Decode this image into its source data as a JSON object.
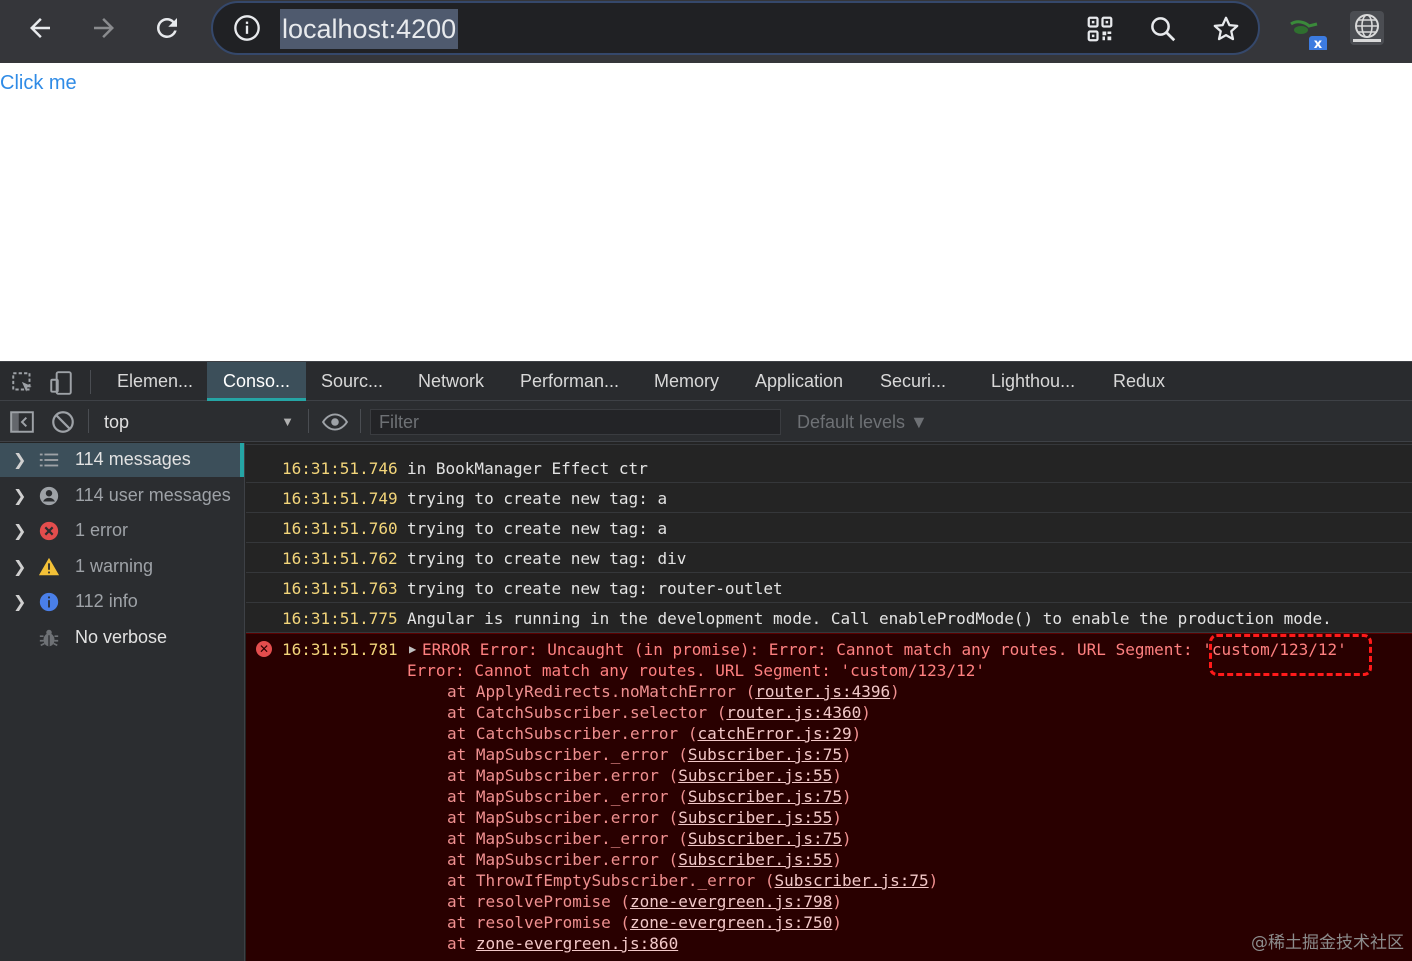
{
  "browser": {
    "url": "localhost:4200",
    "ext_badge": "x"
  },
  "page": {
    "link_text": "Click me"
  },
  "devtools": {
    "tabs": [
      {
        "label": "Elemen..."
      },
      {
        "label": "Conso..."
      },
      {
        "label": "Sourc..."
      },
      {
        "label": "Network"
      },
      {
        "label": "Performan..."
      },
      {
        "label": "Memory"
      },
      {
        "label": "Application"
      },
      {
        "label": "Securi..."
      },
      {
        "label": "Lighthou..."
      },
      {
        "label": "Redux"
      }
    ],
    "context": "top",
    "filter_placeholder": "Filter",
    "levels": "Default levels ▼",
    "sidebar": [
      {
        "label": "114 messages"
      },
      {
        "label": "114 user messages"
      },
      {
        "label": "1 error"
      },
      {
        "label": "1 warning"
      },
      {
        "label": "112 info"
      },
      {
        "label": "No verbose"
      }
    ],
    "logs": [
      {
        "time": "16:31:51.746",
        "text": "in BookManager Effect ctr"
      },
      {
        "time": "16:31:51.749",
        "text": "trying to create new tag: a"
      },
      {
        "time": "16:31:51.760",
        "text": "trying to create new tag: a"
      },
      {
        "time": "16:31:51.762",
        "text": "trying to create new tag: div"
      },
      {
        "time": "16:31:51.763",
        "text": "trying to create new tag: router-outlet"
      },
      {
        "time": "16:31:51.775",
        "text": "Angular is running in the development mode. Call enableProdMode() to enable the production mode."
      }
    ],
    "error": {
      "time": "16:31:51.781",
      "headline": "ERROR Error: Uncaught (in promise): Error: Cannot match any routes. URL Segment: ",
      "segment": "'custom/123/12'",
      "line2": "Error: Cannot match any routes. URL Segment: 'custom/123/12'",
      "stack": [
        {
          "fn": "at ApplyRedirects.noMatchError (",
          "src": "router.js:4396",
          "end": ")"
        },
        {
          "fn": "at CatchSubscriber.selector (",
          "src": "router.js:4360",
          "end": ")"
        },
        {
          "fn": "at CatchSubscriber.error (",
          "src": "catchError.js:29",
          "end": ")"
        },
        {
          "fn": "at MapSubscriber._error (",
          "src": "Subscriber.js:75",
          "end": ")"
        },
        {
          "fn": "at MapSubscriber.error (",
          "src": "Subscriber.js:55",
          "end": ")"
        },
        {
          "fn": "at MapSubscriber._error (",
          "src": "Subscriber.js:75",
          "end": ")"
        },
        {
          "fn": "at MapSubscriber.error (",
          "src": "Subscriber.js:55",
          "end": ")"
        },
        {
          "fn": "at MapSubscriber._error (",
          "src": "Subscriber.js:75",
          "end": ")"
        },
        {
          "fn": "at MapSubscriber.error (",
          "src": "Subscriber.js:55",
          "end": ")"
        },
        {
          "fn": "at ThrowIfEmptySubscriber._error (",
          "src": "Subscriber.js:75",
          "end": ")"
        },
        {
          "fn": "at resolvePromise (",
          "src": "zone-evergreen.js:798",
          "end": ")"
        },
        {
          "fn": "at resolvePromise (",
          "src": "zone-evergreen.js:750",
          "end": ")"
        },
        {
          "fn": "at ",
          "src": "zone-evergreen.js:860",
          "end": ""
        }
      ]
    }
  },
  "watermark": "@稀土掘金技术社区",
  "colors": {
    "accent": "#25a5a5",
    "error_bg": "#290000",
    "timestamp": "#f3d57a",
    "link": "#2f8be6"
  }
}
